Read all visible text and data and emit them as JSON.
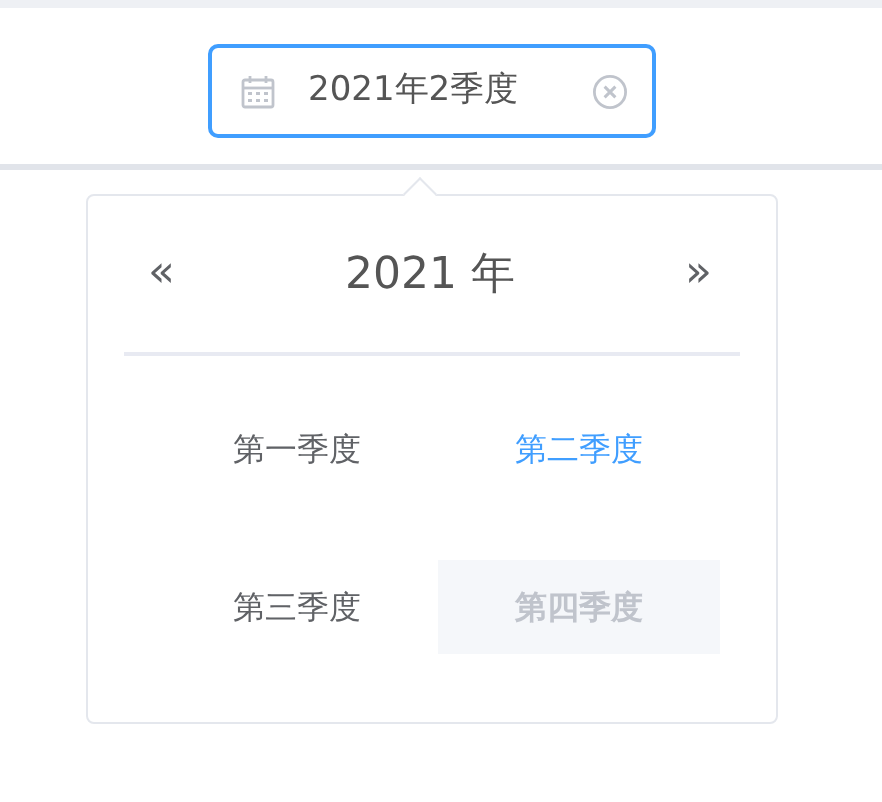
{
  "picker": {
    "value": "2021年2季度"
  },
  "panel": {
    "prev": "«",
    "year": "2021 年",
    "next": "»"
  },
  "quarters": [
    {
      "label": "第一季度",
      "selected": false,
      "disabled": false
    },
    {
      "label": "第二季度",
      "selected": true,
      "disabled": false
    },
    {
      "label": "第三季度",
      "selected": false,
      "disabled": false
    },
    {
      "label": "第四季度",
      "selected": false,
      "disabled": true
    }
  ]
}
